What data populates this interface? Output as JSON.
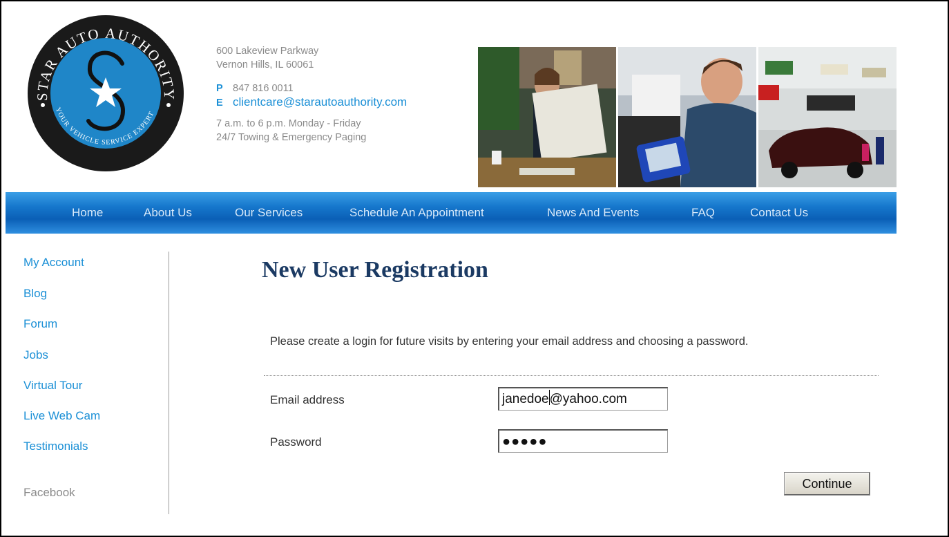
{
  "logo": {
    "arc_text_top": "STAR AUTO AUTHORITY",
    "arc_text_bottom": "YOUR VEHICLE SERVICE EXPERTS"
  },
  "contact": {
    "address_line1": "600 Lakeview Parkway",
    "address_line2": "Vernon Hills, IL 60061",
    "phone_label": "P",
    "phone": "847 816 0011",
    "email_label": "E",
    "email": "clientcare@starautoauthority.com",
    "hours_line1": "7 a.m. to 6 p.m. Monday - Friday",
    "hours_line2": "24/7 Towing & Emergency Paging"
  },
  "nav": {
    "items": [
      {
        "label": "Home"
      },
      {
        "label": "About Us"
      },
      {
        "label": "Our Services"
      },
      {
        "label": "Schedule An Appointment"
      },
      {
        "label": "News And Events"
      },
      {
        "label": "FAQ"
      },
      {
        "label": "Contact Us"
      }
    ]
  },
  "sidebar": {
    "items": [
      {
        "label": "My Account"
      },
      {
        "label": "Blog"
      },
      {
        "label": "Forum"
      },
      {
        "label": "Jobs"
      },
      {
        "label": "Virtual Tour"
      },
      {
        "label": "Live Web Cam"
      },
      {
        "label": "Testimonials"
      },
      {
        "label": "Facebook"
      }
    ]
  },
  "main": {
    "title": "New User Registration",
    "intro": "Please create a login for future visits by entering your email address and choosing a password.",
    "email_label": "Email address",
    "email_value_before_caret": "janedoe",
    "email_value_after_caret": "@yahoo.com",
    "password_label": "Password",
    "password_mask": "●●●●●",
    "continue_label": "Continue"
  },
  "colors": {
    "accent": "#1a8fd6",
    "nav_blue": "#1677cc",
    "title": "#1b3a63",
    "logo_blue": "#1f86c8"
  }
}
